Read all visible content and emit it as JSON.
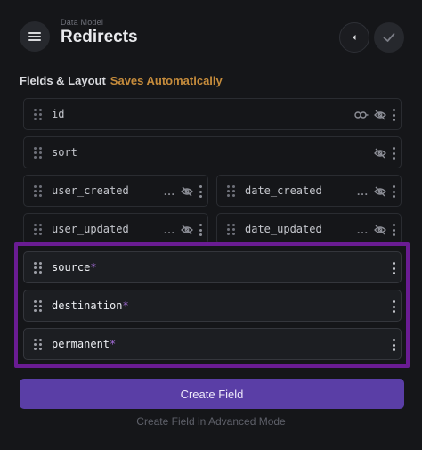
{
  "header": {
    "breadcrumb": "Data Model",
    "title": "Redirects",
    "icons": {
      "menu": "hamburger-icon",
      "back": "chevron-left-icon",
      "save": "check-icon"
    }
  },
  "section": {
    "label": "Fields & Layout",
    "status": "Saves Automatically"
  },
  "fields": [
    {
      "name": "id",
      "required": false,
      "icons": [
        "key-icon",
        "eye-off-icon",
        "more-vertical-icon"
      ]
    },
    {
      "name": "sort",
      "required": false,
      "icons": [
        "eye-off-icon",
        "more-vertical-icon"
      ]
    },
    {
      "name": "user_created",
      "required": false,
      "ellipsis": "...",
      "icons": [
        "eye-off-icon",
        "more-vertical-icon"
      ]
    },
    {
      "name": "date_created",
      "required": false,
      "ellipsis": "...",
      "icons": [
        "eye-off-icon",
        "more-vertical-icon"
      ]
    },
    {
      "name": "user_updated",
      "required": false,
      "ellipsis": "...",
      "icons": [
        "eye-off-icon",
        "more-vertical-icon"
      ]
    },
    {
      "name": "date_updated",
      "required": false,
      "ellipsis": "...",
      "icons": [
        "eye-off-icon",
        "more-vertical-icon"
      ]
    },
    {
      "name": "source",
      "required": true,
      "required_mark": "*",
      "icons": [
        "more-vertical-icon"
      ]
    },
    {
      "name": "destination",
      "required": true,
      "required_mark": "*",
      "icons": [
        "more-vertical-icon"
      ]
    },
    {
      "name": "permanent",
      "required": true,
      "required_mark": "*",
      "icons": [
        "more-vertical-icon"
      ]
    }
  ],
  "actions": {
    "create_field": "Create Field",
    "advanced_mode": "Create Field in Advanced Mode"
  },
  "colors": {
    "accent": "#5a3ea6",
    "highlight": "#6a1c93",
    "status": "#c68c3c"
  }
}
